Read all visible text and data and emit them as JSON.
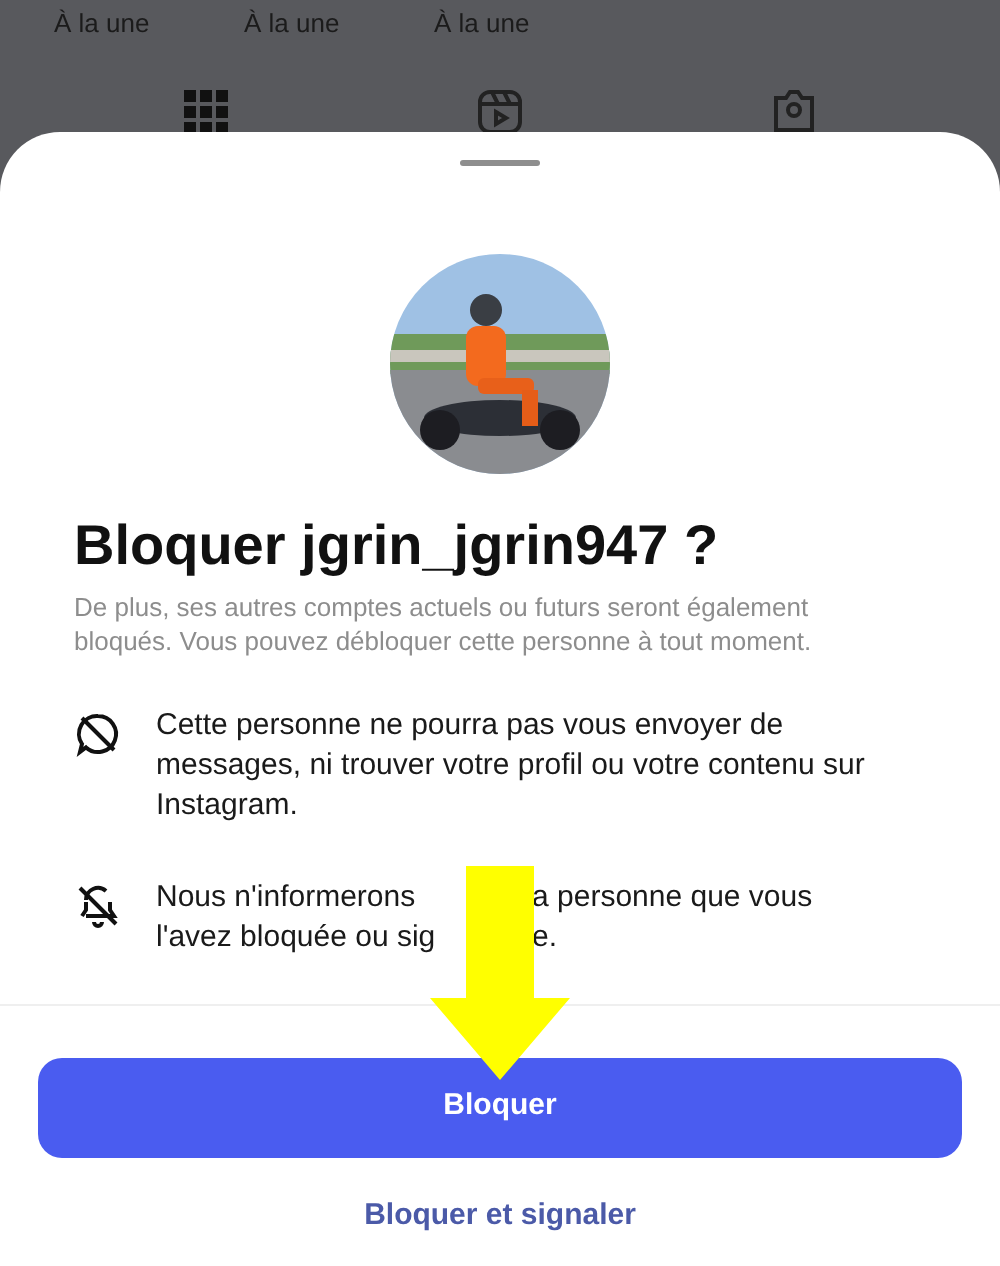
{
  "background": {
    "highlights": [
      {
        "label": "À la une"
      },
      {
        "label": "À la une"
      },
      {
        "label": "À la une"
      }
    ],
    "tabs": [
      {
        "kind": "grid"
      },
      {
        "kind": "reels"
      },
      {
        "kind": "tagged"
      }
    ]
  },
  "sheet": {
    "title": "Bloquer jgrin_jgrin947 ?",
    "subtitle": "De plus, ses autres comptes actuels ou futurs seront également bloqués. Vous pouvez débloquer cette personne à tout moment.",
    "items": [
      {
        "kind": "message-off",
        "lines": [
          [
            "Cette personne ne pourra pas vous envoyer de messages, ni trouver votre profil ou votre contenu sur Instagram."
          ]
        ]
      },
      {
        "kind": "notification-off",
        "lines": [
          [
            "Nous n'informerons",
            "a personne que vous"
          ],
          [
            "l'avez bloquée ou sig",
            "e."
          ]
        ]
      }
    ],
    "primary_button": "Bloquer",
    "secondary_button": "Bloquer et signaler"
  },
  "annotation": {
    "kind": "arrow"
  }
}
